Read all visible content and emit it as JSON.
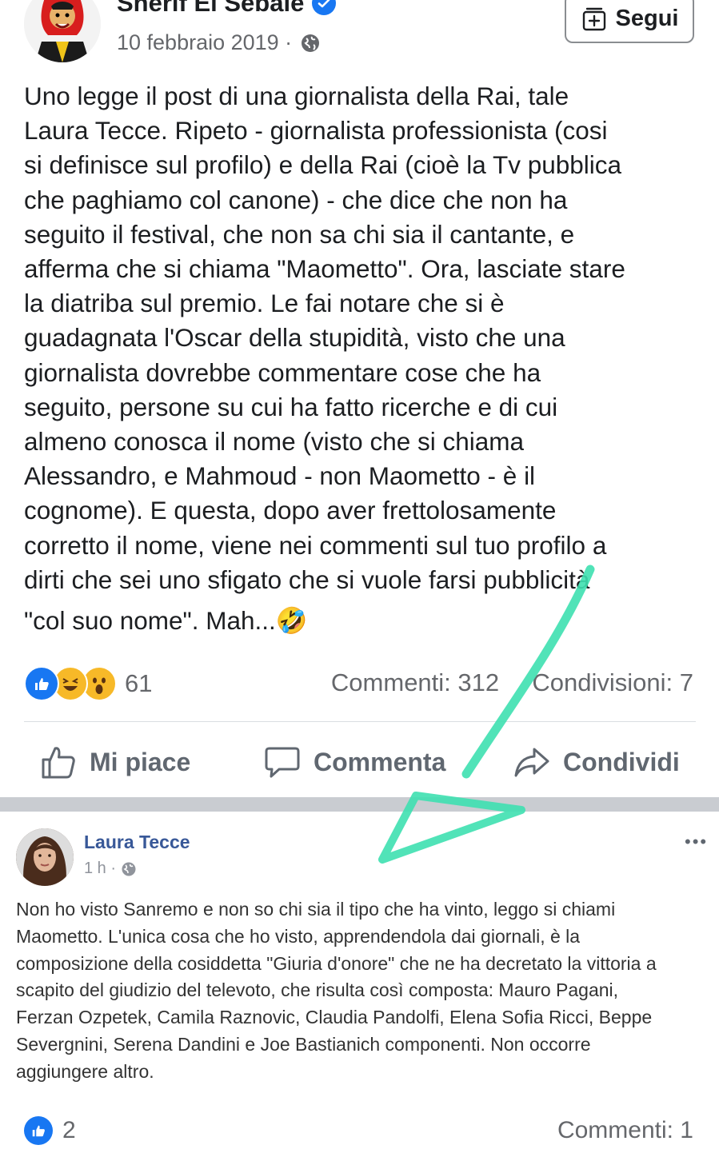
{
  "post": {
    "author": "Sherif El Sebaie",
    "date": "10 febbraio 2019 ·",
    "follow_label": "Segui",
    "text_lines": [
      "Uno legge il post di una giornalista della Rai, tale",
      "Laura Tecce. Ripeto - giornalista professionista (cosi",
      "si definisce sul profilo) e della Rai (cioè la Tv pubblica",
      "che paghiamo col canone) - che dice che non ha",
      "seguito il festival, che non sa chi sia il cantante, e",
      "afferma che si chiama \"Maometto\". Ora, lasciate stare",
      "la diatriba sul premio. Le fai notare che si è",
      "guadagnata l'Oscar della stupidità, visto che una",
      "giornalista dovrebbe commentare cose che ha",
      "seguito, persone su cui ha fatto ricerche e di cui",
      "almeno conosca il nome (visto che si chiama",
      "Alessandro, e Mahmoud - non Maometto - è il",
      "cognome). E questa, dopo aver frettolosamente",
      "corretto il nome, viene nei commenti sul tuo profilo a",
      "dirti che sei uno sfigato che si vuole farsi pubblicità",
      "\"col suo nome\". Mah..."
    ],
    "emoji": "🤣",
    "reactions": [
      "like-icon",
      "laugh-icon",
      "wow-icon"
    ],
    "reaction_count": "61",
    "comments": "Commenti: 312",
    "shares": "Condivisioni: 7",
    "actions": {
      "like": "Mi piace",
      "comment": "Commenta",
      "share": "Condividi"
    }
  },
  "comment_post": {
    "author": "Laura Tecce",
    "time": "1 h ·",
    "more": "•••",
    "text_lines": [
      "Non ho visto Sanremo e non so chi sia il tipo che ha vinto, leggo si chiami",
      "Maometto. L'unica cosa che ho visto, apprendendola dai giornali, è la",
      "composizione della cosiddetta \"Giuria d'onore\" che ne ha decretato la vittoria a",
      "scapito del giudizio del televoto, che risulta così composta: Mauro Pagani,",
      "Ferzan Ozpetek, Camila Raznovic, Claudia Pandolfi, Elena Sofia Ricci, Beppe",
      "Severgnini, Serena Dandini e Joe Bastianich componenti. Non occorre",
      "aggiungere altro."
    ],
    "like_count": "2",
    "comments": "Commenti: 1"
  },
  "colors": {
    "facebook_blue": "#1877f2",
    "annotation": "#3ee0b0",
    "band": "#c9ccd1"
  }
}
